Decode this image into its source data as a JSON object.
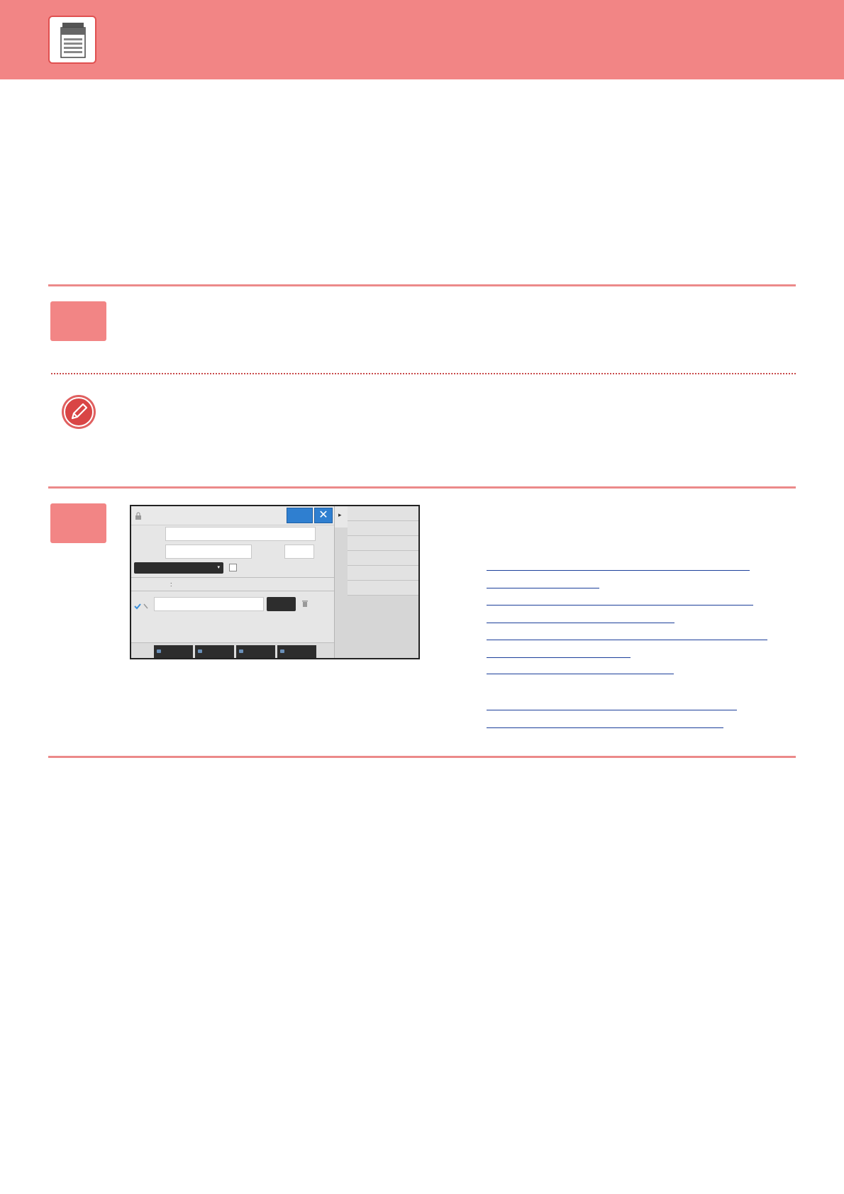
{
  "header": {
    "icon": "printer-icon",
    "background_color": "#f28585"
  },
  "step1": {
    "badge_color": "#f28585"
  },
  "note": {
    "icon": "pencil-note-icon"
  },
  "step2": {
    "badge_color": "#f28585",
    "screenshot": {
      "close_glyph": "✕",
      "separator_glyph": ":",
      "dropdown_glyph": "▾",
      "side_arrow_glyph": "▸"
    }
  },
  "colors": {
    "accent": "#f28585",
    "rule": "#ec8a8a",
    "link": "#1c3f9a",
    "button_blue": "#2f7fd0"
  }
}
